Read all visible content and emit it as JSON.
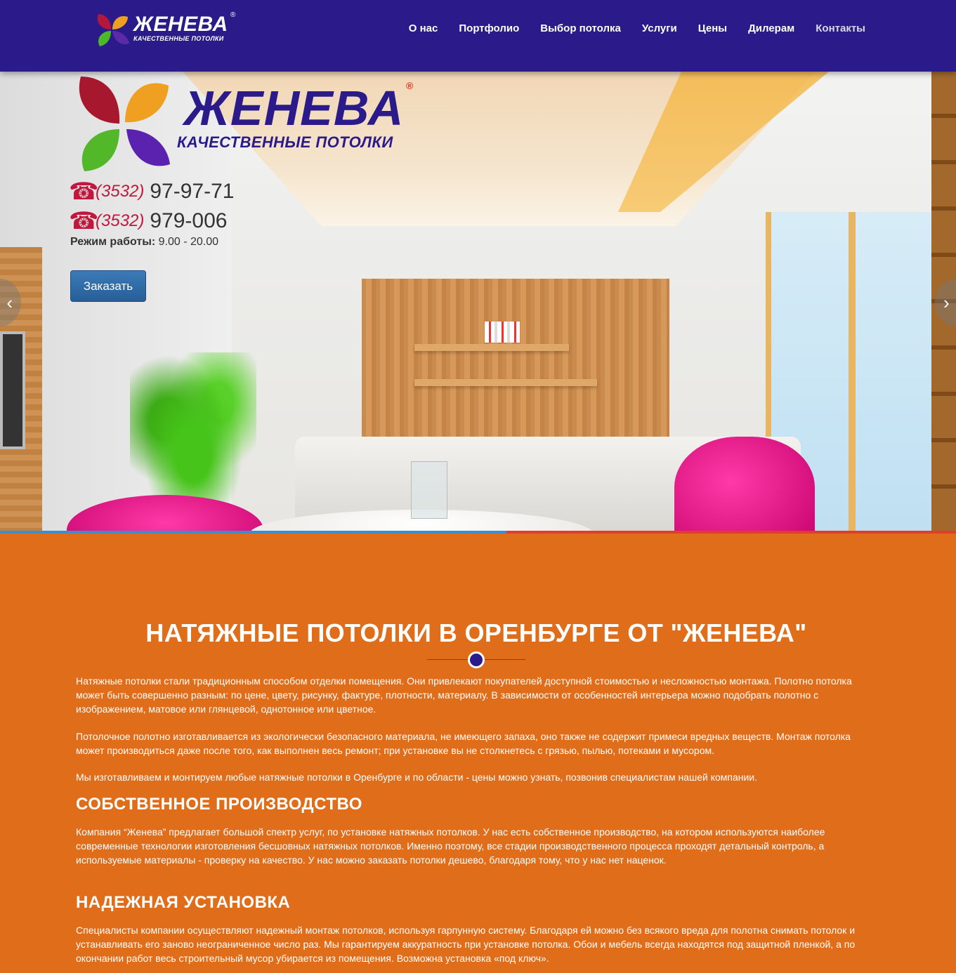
{
  "header": {
    "logo_brand": "ЖЕНЕВА",
    "logo_reg": "®",
    "logo_tagline": "КАЧЕСТВЕННЫЕ ПОТОЛКИ",
    "nav": [
      {
        "label": "О нас"
      },
      {
        "label": "Портфолио"
      },
      {
        "label": "Выбор потолка"
      },
      {
        "label": "Услуги"
      },
      {
        "label": "Цены"
      },
      {
        "label": "Дилерам"
      },
      {
        "label": "Контакты"
      }
    ]
  },
  "hero": {
    "logo_brand": "ЖЕНЕВА",
    "logo_reg": "®",
    "logo_tagline": "КАЧЕСТВЕННЫЕ ПОТОЛКИ",
    "phones": [
      {
        "code": "(3532)",
        "number": "97-97-71"
      },
      {
        "code": "(3532)",
        "number": "979-006"
      }
    ],
    "hours_label": "Режим работы:",
    "hours_value": "9.00 - 20.00",
    "order_button": "Заказать",
    "prev_arrow": "‹",
    "next_arrow": "›",
    "slide_progress": 0.53
  },
  "content": {
    "title": "НАТЯЖНЫЕ ПОТОЛКИ В ОРЕНБУРГЕ ОТ \"ЖЕНЕВА\"",
    "paragraphs": [
      "Натяжные потолки стали традиционным способом отделки помещения. Они привлекают покупателей доступной стоимостью и несложностью монтажа. Полотно потолка может быть совершенно разным: по цене, цвету, рисунку, фактуре, плотности, материалу. В зависимости от особенностей интерьера можно подобрать полотно с изображением, матовое или глянцевой, однотонное или цветное.",
      "Потолочное полотно изготавливается из экологически безопасного материала, не имеющего запаха, оно также не содержит примеси вредных веществ. Монтаж потолка может производиться даже после того, как выполнен весь ремонт; при установке вы не  столкнетесь с грязью, пылью, потеками и мусором.",
      "Мы изготавливаем и монтируем любые натяжные потолки в Оренбурге и по области - цены можно узнать, позвонив специалистам нашей компании."
    ],
    "section1_title": "СОБСТВЕННОЕ ПРОИЗВОДСТВО",
    "section1_text": "Компания “Женева” предлагает большой спектр услуг, по установке натяжных потолков. У нас есть собственное производство, на котором используются наиболее современные технологии изготовления бесшовных натяжных потолков. Именно поэтому, все стадии производственного процесса проходят детальный контроль, а используемые материалы - проверку на качество. У нас можно заказать потолки дешево, благодаря тому, что у нас нет наценок.",
    "section2_title": "НАДЕЖНАЯ УСТАНОВКА",
    "section2_text": "Специалисты компании осуществляют надежный монтаж потолков, используя гарпунную систему. Благодаря ей можно без всякого вреда для полотна снимать потолок и устанавливать его заново неограниченное число раз. Мы гарантируем аккуратность при установке потолка. Обои и мебель всегда находятся под защитной пленкой, а по окончании работ весь строительный мусор убирается из помещения. Возможна установка «под ключ»."
  },
  "colors": {
    "header_bg": "#2a1a8a",
    "content_bg": "#e06d1a",
    "phone_accent": "#c0173c",
    "button": "#2f6ca8"
  }
}
